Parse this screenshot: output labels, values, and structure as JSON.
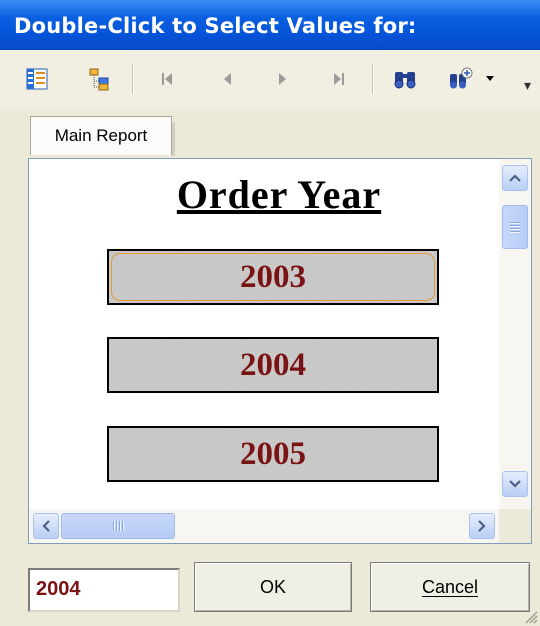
{
  "window": {
    "title": "Double-Click to Select Values for:"
  },
  "toolbar": {
    "buttons": [
      {
        "name": "toggle-tree-icon"
      },
      {
        "name": "group-tree-icon"
      },
      {
        "name": "first-page-icon"
      },
      {
        "name": "previous-page-icon"
      },
      {
        "name": "next-page-icon"
      },
      {
        "name": "last-page-icon"
      },
      {
        "name": "search-icon"
      },
      {
        "name": "zoom-icon"
      }
    ],
    "overflow_glyph": "▾"
  },
  "tabs": {
    "main": "Main Report"
  },
  "report": {
    "heading": "Order Year",
    "years": [
      "2003",
      "2004",
      "2005"
    ],
    "focused_index": 0
  },
  "bottom": {
    "value": "2004",
    "ok_label": "OK",
    "cancel_label": "Cancel"
  },
  "colors": {
    "title_bar": "#0553d8",
    "year_text": "#7a1414",
    "focus": "#e69a3a"
  }
}
